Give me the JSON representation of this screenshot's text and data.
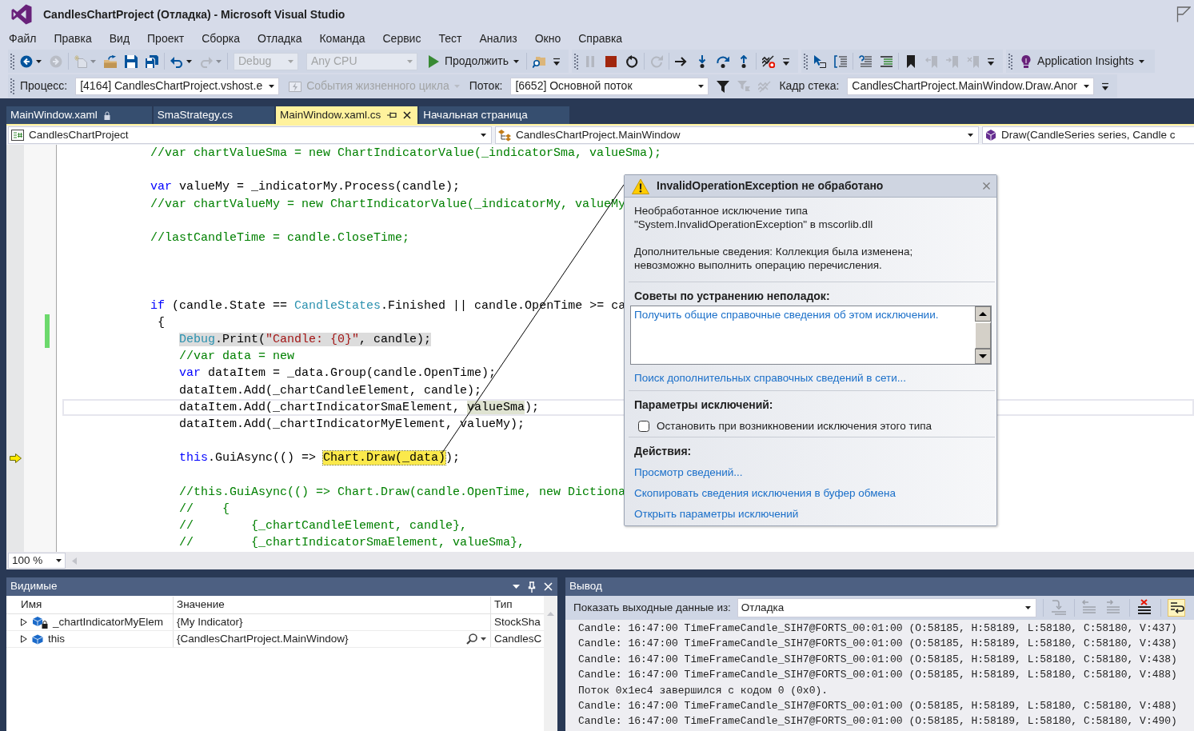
{
  "window": {
    "title": "CandlesChartProject (Отладка) - Microsoft Visual Studio"
  },
  "menu": [
    "Файл",
    "Правка",
    "Вид",
    "Проект",
    "Сборка",
    "Отладка",
    "Команда",
    "Сервис",
    "Тест",
    "Анализ",
    "Окно",
    "Справка"
  ],
  "toolbars": [
    {
      "bands": [
        {
          "groups": [
            {
              "items": [
                {
                  "kind": "icon",
                  "disabled": false
                },
                {
                  "kind": "icon",
                  "disabled": true
                }
              ]
            },
            {
              "items": [
                {
                  "kind": "icon",
                  "disabled": true
                },
                {
                  "kind": "icon",
                  "disabled": false
                },
                {
                  "kind": "icon",
                  "disabled": false
                },
                {
                  "kind": "icon",
                  "disabled": false
                }
              ]
            },
            {
              "items": [
                {
                  "kind": "icon",
                  "disabled": false
                },
                {
                  "kind": "icon",
                  "disabled": true
                }
              ]
            },
            {
              "items": [
                {
                  "kind": "combo",
                  "value": "Debug",
                  "disabled": true
                },
                {
                  "kind": "combo",
                  "value": "Any CPU",
                  "disabled": true
                },
                {
                  "kind": "button",
                  "label": "Продолжить",
                  "disabled": false
                }
              ]
            },
            {
              "items": [
                {
                  "kind": "icon",
                  "disabled": false
                },
                {
                  "kind": "overflow"
                }
              ]
            }
          ]
        },
        {
          "groups": [
            {
              "items": [
                {
                  "kind": "icon",
                  "disabled": true
                },
                {
                  "kind": "icon",
                  "disabled": false
                },
                {
                  "kind": "icon",
                  "disabled": false
                }
              ]
            },
            {
              "items": [
                {
                  "kind": "icon",
                  "disabled": true
                }
              ]
            },
            {
              "items": [
                {
                  "kind": "icon",
                  "disabled": false
                },
                {
                  "kind": "icon",
                  "disabled": false
                },
                {
                  "kind": "icon",
                  "disabled": false
                },
                {
                  "kind": "icon",
                  "disabled": false
                }
              ]
            },
            {
              "items": [
                {
                  "kind": "icon",
                  "disabled": false
                },
                {
                  "kind": "overflow"
                }
              ]
            }
          ]
        },
        {
          "groups": [
            {
              "items": [
                {
                  "kind": "icon",
                  "disabled": false
                },
                {
                  "kind": "icon",
                  "disabled": false
                }
              ]
            },
            {
              "items": [
                {
                  "kind": "icon",
                  "disabled": false
                },
                {
                  "kind": "icon",
                  "disabled": false
                }
              ]
            },
            {
              "items": [
                {
                  "kind": "icon",
                  "disabled": false
                },
                {
                  "kind": "icon",
                  "disabled": true
                },
                {
                  "kind": "icon",
                  "disabled": true
                },
                {
                  "kind": "icon",
                  "disabled": true
                },
                {
                  "kind": "overflow"
                }
              ]
            }
          ]
        },
        {
          "groups": [
            {
              "items": [
                {
                  "kind": "button",
                  "label": "Application Insights",
                  "disabled": false
                }
              ]
            }
          ]
        }
      ]
    },
    {
      "bands": [
        {
          "groups": [
            {
              "items": [
                {
                  "kind": "label",
                  "text": "Процесс:"
                },
                {
                  "kind": "combo",
                  "value": "[4164] CandlesChartProject.vshost.e",
                  "disabled": false
                },
                {
                  "kind": "button",
                  "label": "События жизненного цикла",
                  "disabled": true
                },
                {
                  "kind": "label",
                  "text": "Поток:"
                },
                {
                  "kind": "combo",
                  "value": "[6652] Основной поток",
                  "disabled": false
                },
                {
                  "kind": "icon",
                  "disabled": false
                },
                {
                  "kind": "icon",
                  "disabled": true
                },
                {
                  "kind": "icon",
                  "disabled": true
                },
                {
                  "kind": "label",
                  "text": "Кадр стека:"
                },
                {
                  "kind": "combo",
                  "value": "CandlesChartProject.MainWindow.Draw.Anor",
                  "disabled": false
                },
                {
                  "kind": "overflow"
                }
              ]
            }
          ]
        }
      ]
    }
  ],
  "tabs": [
    {
      "label": "MainWindow.xaml",
      "selected": false,
      "read_only": true
    },
    {
      "label": "SmaStrategy.cs",
      "selected": false,
      "read_only": false
    },
    {
      "label": "MainWindow.xaml.cs",
      "selected": true,
      "read_only": false
    },
    {
      "label": "Начальная страница",
      "selected": false,
      "read_only": false
    }
  ],
  "navigation_bar": {
    "project": "CandlesChartProject",
    "type": "CandlesChartProject.MainWindow",
    "member": "Draw(CandleSeries series, Candle c"
  },
  "editor": {
    "lines": [
      {
        "tokens": [
          {
            "kind": "comment",
            "text": "            //var chartValueSma = new ChartIndicatorValue(_indicatorSma, valueSma);"
          }
        ],
        "selected": false,
        "caret": false,
        "changed": false,
        "execution_point": false
      },
      {
        "selected": false,
        "caret": false,
        "changed": false,
        "execution_point": false
      },
      {
        "tokens": [
          {
            "kind": "keyword",
            "text": "            var"
          },
          {
            "kind": "plain",
            "text": " valueMy = _indicatorMy.Process(candle);"
          }
        ],
        "selected": false,
        "caret": false,
        "changed": false,
        "execution_point": false
      },
      {
        "tokens": [
          {
            "kind": "comment",
            "text": "            //var chartValueMy = new ChartIndicatorValue(_indicatorMy, valueMy"
          }
        ],
        "selected": false,
        "caret": false,
        "changed": false,
        "execution_point": false
      },
      {
        "selected": false,
        "caret": false,
        "changed": false,
        "execution_point": false
      },
      {
        "tokens": [
          {
            "kind": "comment",
            "text": "            //lastCandleTime = candle.CloseTime;"
          }
        ],
        "selected": false,
        "caret": false,
        "changed": false,
        "execution_point": false
      },
      {
        "selected": false,
        "caret": false,
        "changed": false,
        "execution_point": false
      },
      {
        "selected": false,
        "caret": false,
        "changed": false,
        "execution_point": false
      },
      {
        "selected": false,
        "caret": false,
        "changed": false,
        "execution_point": false
      },
      {
        "tokens": [
          {
            "kind": "keyword",
            "text": "            if"
          },
          {
            "kind": "plain",
            "text": " (candle.State == "
          },
          {
            "kind": "type",
            "text": "CandleStates"
          },
          {
            "kind": "plain",
            "text": ".Finished || candle.OpenTime >= ca"
          }
        ],
        "selected": false,
        "caret": false,
        "changed": false,
        "execution_point": false
      },
      {
        "tokens": [
          {
            "kind": "plain",
            "text": "             {"
          }
        ],
        "selected": false,
        "caret": false,
        "changed": true,
        "execution_point": false
      },
      {
        "tokens": [
          {
            "kind": "type",
            "text": "                Debug"
          },
          {
            "kind": "plain",
            "text": ".Print("
          },
          {
            "kind": "string",
            "text": "\"Candle: {0}\""
          },
          {
            "kind": "plain",
            "text": ", candle);"
          }
        ],
        "selected": true,
        "caret": false,
        "changed": true,
        "execution_point": false
      },
      {
        "tokens": [
          {
            "kind": "comment",
            "text": "                //var data = new"
          }
        ],
        "selected": false,
        "caret": false,
        "changed": false,
        "execution_point": false
      },
      {
        "tokens": [
          {
            "kind": "keyword",
            "text": "                var"
          },
          {
            "kind": "plain",
            "text": " dataItem = _data.Group(candle.OpenTime);"
          }
        ],
        "selected": false,
        "caret": false,
        "changed": false,
        "execution_point": false
      },
      {
        "tokens": [
          {
            "kind": "plain",
            "text": "                dataItem.Add(_chartCandleElement, candle);"
          }
        ],
        "selected": false,
        "caret": false,
        "changed": false,
        "execution_point": false
      },
      {
        "tokens": [
          {
            "kind": "plain",
            "text": "                dataItem.Add(_chartIndicatorSmaElement, ",
            "highlighted": false
          },
          {
            "kind": "plain",
            "text": "valueSma",
            "highlighted": true
          },
          {
            "kind": "plain",
            "text": ");",
            "highlighted": false
          }
        ],
        "selected": false,
        "caret": true,
        "changed": false,
        "execution_point": false
      },
      {
        "tokens": [
          {
            "kind": "plain",
            "text": "                dataItem.Add(_chartIndicatorMyElement, valueMy);"
          }
        ],
        "selected": false,
        "caret": false,
        "changed": false,
        "execution_point": false
      },
      {
        "selected": false,
        "caret": false,
        "changed": false,
        "execution_point": false
      },
      {
        "tokens": [
          {
            "kind": "keyword",
            "text": "                this",
            "highlighted": false
          },
          {
            "kind": "plain",
            "text": ".GuiAsync(() => ",
            "highlighted": false
          },
          {
            "kind": "plain",
            "text": "Chart.Draw(_data)",
            "highlighted": true
          },
          {
            "kind": "plain",
            "text": ");",
            "highlighted": false
          }
        ],
        "selected": false,
        "caret": false,
        "changed": false,
        "execution_point": true
      },
      {
        "selected": false,
        "caret": false,
        "changed": false,
        "execution_point": false
      },
      {
        "tokens": [
          {
            "kind": "comment",
            "text": "                //this.GuiAsync(() => Chart.Draw(candle.OpenTime, new Dictiona"
          }
        ],
        "selected": false,
        "caret": false,
        "changed": false,
        "execution_point": false
      },
      {
        "tokens": [
          {
            "kind": "comment",
            "text": "                //    {"
          }
        ],
        "selected": false,
        "caret": false,
        "changed": false,
        "execution_point": false
      },
      {
        "tokens": [
          {
            "kind": "comment",
            "text": "                //        {_chartCandleElement, candle},"
          }
        ],
        "selected": false,
        "caret": false,
        "changed": false,
        "execution_point": false
      },
      {
        "tokens": [
          {
            "kind": "comment",
            "text": "                //        {_chartIndicatorSmaElement, valueSma},"
          }
        ],
        "selected": false,
        "caret": false,
        "changed": false,
        "execution_point": false
      }
    ],
    "zoom": "100 %"
  },
  "exception_popup": {
    "title": "InvalidOperationException не обработано",
    "message": [
      "Необработанное исключение типа \"System.InvalidOperationException\" в mscorlib.dll",
      "Дополнительные сведения: Коллекция была изменена; невозможно выполнить операцию перечисления."
    ],
    "troubleshooting": {
      "heading": "Советы по устранению неполадок:",
      "tips": [
        "Получить общие справочные сведения об этом исключении."
      ],
      "search_link": "Поиск дополнительных справочных сведений в сети..."
    },
    "exception_settings": {
      "heading": "Параметры исключений:",
      "break_option": {
        "label": "Остановить при возникновении исключения этого типа",
        "checked": false
      }
    },
    "actions": {
      "heading": "Действия:",
      "links": [
        "Просмотр сведений...",
        "Скопировать сведения исключения в буфер обмена",
        "Открыть параметры исключений"
      ]
    }
  },
  "autos_panel": {
    "title": "Видимые",
    "columns": [
      "Имя",
      "Значение",
      "Тип"
    ],
    "rows": [
      {
        "kind": "field",
        "name": "_chartIndicatorMyElem",
        "value": "{My Indicator}",
        "type": "StockSha",
        "expanded": false,
        "visualizer": false
      },
      {
        "kind": "object",
        "name": "this",
        "value": "{CandlesChartProject.MainWindow}",
        "type": "CandlesC",
        "expanded": false,
        "visualizer": true
      }
    ]
  },
  "output_panel": {
    "title": "Вывод",
    "source_label": "Показать выходные данные из:",
    "source": "Отладка",
    "toolbar_buttons": [
      {
        "disabled": true,
        "checked": false
      },
      {
        "disabled": true,
        "checked": false
      },
      {
        "disabled": true,
        "checked": false
      },
      {
        "disabled": false,
        "checked": false
      },
      {
        "disabled": false,
        "checked": true
      }
    ],
    "lines": [
      "Candle: 16:47:00 TimeFrameCandle_SIH7@FORTS_00:01:00 (O:58185, H:58189, L:58180, C:58180, V:437)",
      "Candle: 16:47:00 TimeFrameCandle_SIH7@FORTS_00:01:00 (O:58185, H:58189, L:58180, C:58180, V:438)",
      "Candle: 16:47:00 TimeFrameCandle_SIH7@FORTS_00:01:00 (O:58185, H:58189, L:58180, C:58180, V:438)",
      "Candle: 16:47:00 TimeFrameCandle_SIH7@FORTS_00:01:00 (O:58185, H:58189, L:58180, C:58180, V:488)",
      "Поток 0x1ec4 завершился с кодом 0 (0x0).",
      "Candle: 16:47:00 TimeFrameCandle_SIH7@FORTS_00:01:00 (O:58185, H:58189, L:58180, C:58180, V:488)",
      "Candle: 16:47:00 TimeFrameCandle_SIH7@FORTS_00:01:00 (O:58185, H:58189, L:58180, C:58180, V:490)"
    ]
  }
}
